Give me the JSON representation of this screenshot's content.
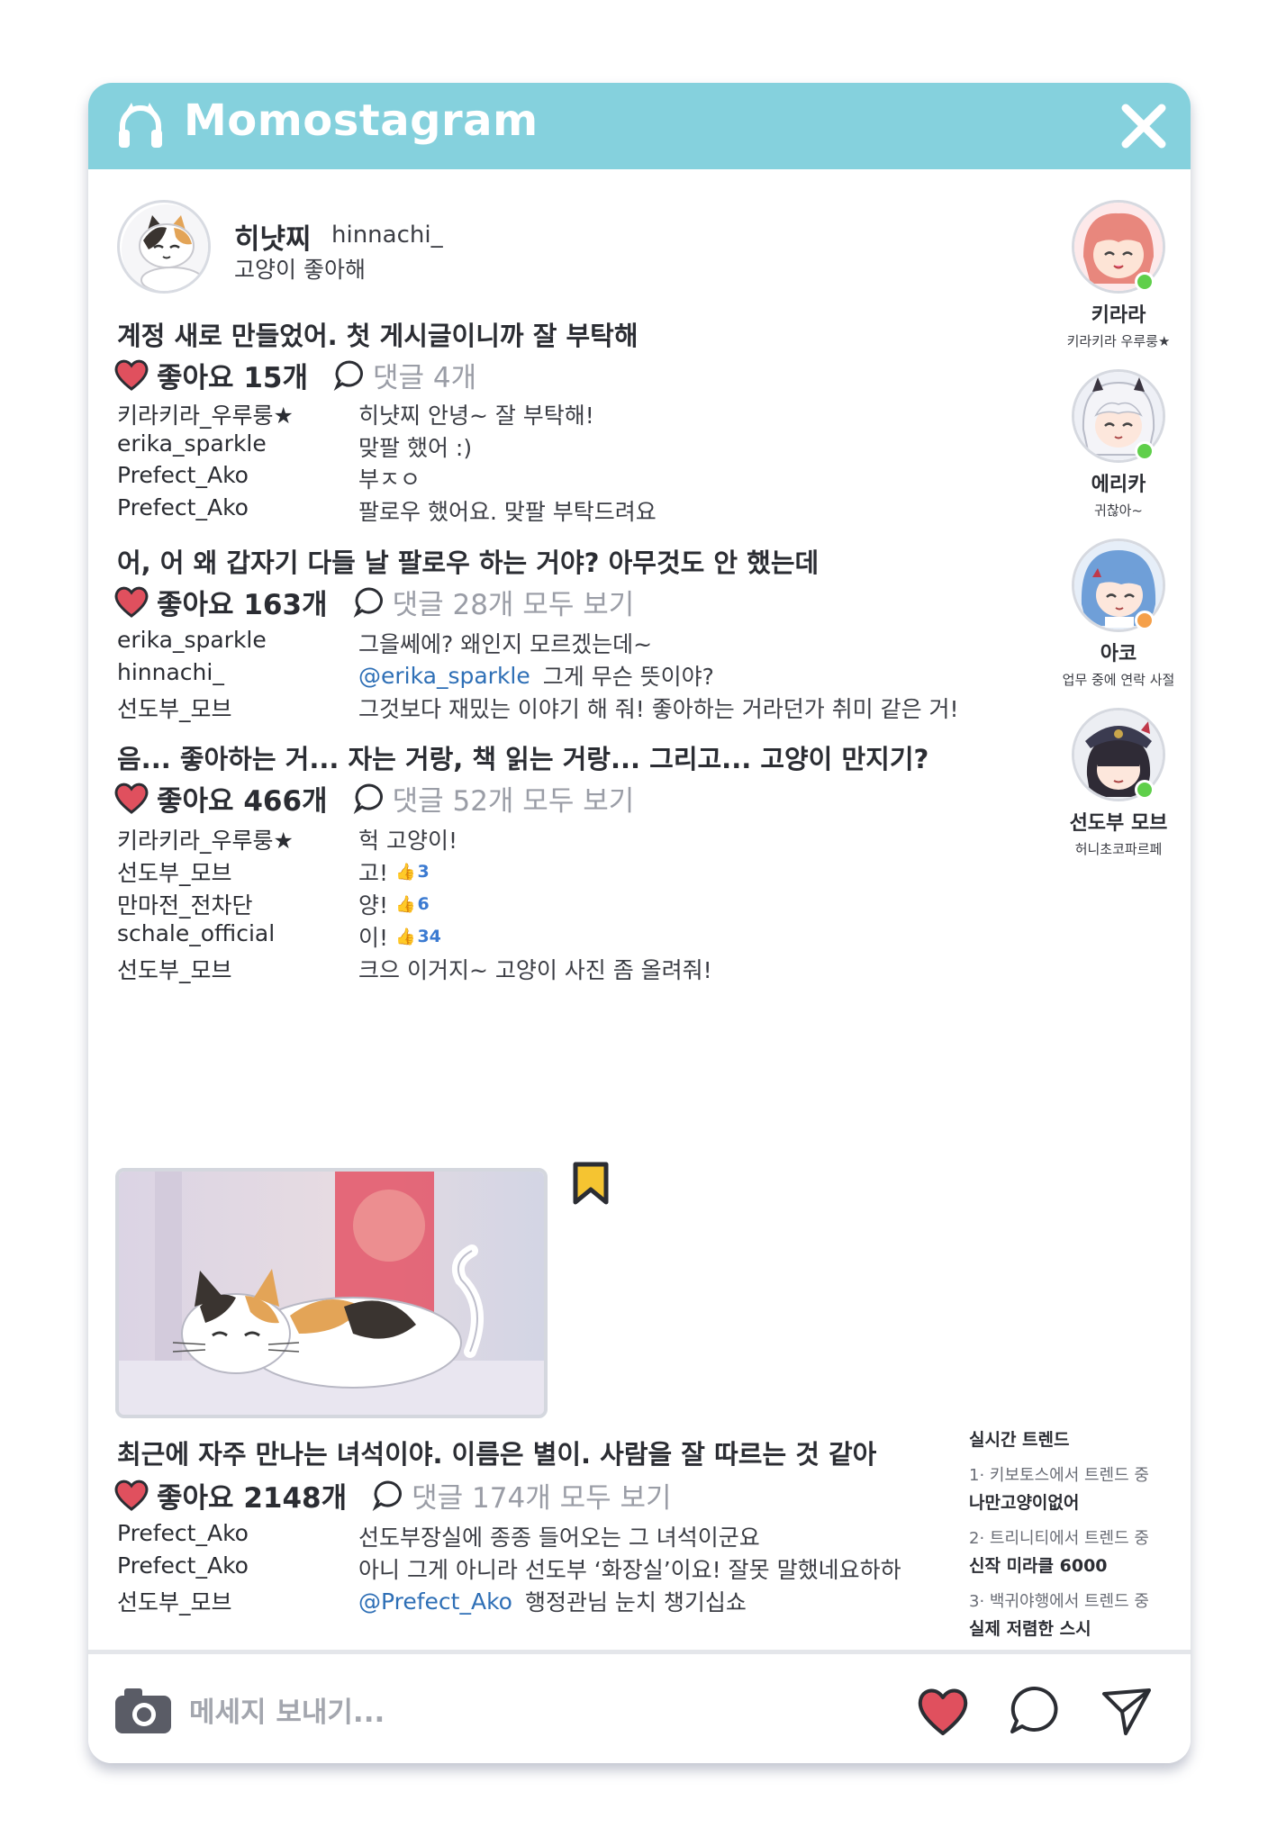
{
  "app": {
    "title": "Momostagram"
  },
  "profile": {
    "name": "히냣찌",
    "handle": "hinnachi_",
    "bio": "고양이 좋아해"
  },
  "posts": [
    {
      "text": "계정 새로 만들었어. 첫 게시글이니까 잘 부탁해",
      "likes": "좋아요 15개",
      "comments_label": "댓글 4개",
      "comments": [
        {
          "user": "키라키라_우루룽★",
          "text": "히냣찌 안녕~ 잘 부탁해!"
        },
        {
          "user": "erika_sparkle",
          "text": "맞팔 했어 :)"
        },
        {
          "user": "Prefect_Ako",
          "text": "부ㅈㅇ"
        },
        {
          "user": "Prefect_Ako",
          "text": "팔로우 했어요. 맞팔 부탁드려요"
        }
      ]
    },
    {
      "text": "어, 어 왜 갑자기 다들 날 팔로우 하는 거야? 아무것도 안 했는데",
      "likes": "좋아요 163개",
      "comments_label": "댓글 28개 모두 보기",
      "comments": [
        {
          "user": "erika_sparkle",
          "text": "그을쎄에? 왜인지 모르겠는데~"
        },
        {
          "user": "hinnachi_",
          "mention": "@erika_sparkle",
          "text": "그게 무슨 뜻이야?"
        },
        {
          "user": "선도부_모브",
          "text": "그것보다 재밌는 이야기 해 줘! 좋아하는 거라던가 취미 같은 거!"
        }
      ]
    },
    {
      "text": "음... 좋아하는 거... 자는 거랑, 책 읽는 거랑... 그리고... 고양이 만지기?",
      "likes": "좋아요 466개",
      "comments_label": "댓글 52개 모두 보기",
      "comments": [
        {
          "user": "키라키라_우루룽★",
          "text": "헉 고양이!"
        },
        {
          "user": "선도부_모브",
          "text": "고!",
          "thumbs": "3"
        },
        {
          "user": "만마전_전차단",
          "text": "양!",
          "thumbs": "6"
        },
        {
          "user": "schale_official",
          "text": "이!",
          "thumbs": "34"
        },
        {
          "user": "선도부_모브",
          "text": "크으 이거지~ 고양이 사진 좀 올려줘!"
        }
      ]
    },
    {
      "text": "최근에 자주 만나는 녀석이야. 이름은 별이. 사람을 잘 따르는 것 같아",
      "likes": "좋아요 2148개",
      "comments_label": "댓글 174개 모두 보기",
      "comments": [
        {
          "user": "Prefect_Ako",
          "text": "선도부장실에 종종 들어오는 그 녀석이군요"
        },
        {
          "user": "Prefect_Ako",
          "text": "아니 그게 아니라 선도부 ‘화장실’이요! 잘못 말했네요하하"
        },
        {
          "user": "선도부_모브",
          "mention": "@Prefect_Ako",
          "text": "행정관님 눈치 챙기십쇼"
        }
      ]
    }
  ],
  "friends": [
    {
      "name": "키라라",
      "status": "키라키라 우루룽★",
      "online_color": "#5fcf4a"
    },
    {
      "name": "에리카",
      "status": "귀찮아~",
      "online_color": "#5fcf4a"
    },
    {
      "name": "아코",
      "status": "업무 중에 연락 사절",
      "online_color": "#f5a04a"
    },
    {
      "name": "선도부 모브",
      "status": "허니초코파르페",
      "online_color": "#5fcf4a"
    }
  ],
  "trends": {
    "title": "실시간 트렌드",
    "items": [
      {
        "source": "1· 키보토스에서 트렌드 중",
        "name": "나만고양이없어"
      },
      {
        "source": "2· 트리니티에서 트렌드 중",
        "name": "신작 미라클 6000"
      },
      {
        "source": "3· 백귀야행에서 트렌드 중",
        "name": "실제 저렴한 스시"
      }
    ]
  },
  "composer": {
    "placeholder": "메세지 보내기..."
  },
  "colors": {
    "accent": "#85d1dd",
    "heart": "#e0505e",
    "mention": "#2e6fb6"
  }
}
